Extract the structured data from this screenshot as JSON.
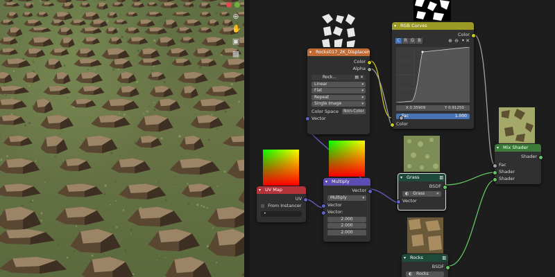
{
  "viewport": {
    "tools": [
      "hand-icon",
      "camera-icon",
      "grid-icon"
    ]
  },
  "nodes": {
    "rocks_texture": {
      "title": "Rocks017_2K_Displacement...",
      "outputs": [
        "Color",
        "Alpha"
      ],
      "image_name": "Rock...",
      "interpolation": "Linear",
      "projection": "Flat",
      "extension": "Repeat",
      "source": "Single Image",
      "color_space_label": "Color Space",
      "color_space_value": "Non-Color",
      "input": "Vector"
    },
    "rgb_curves": {
      "title": "RGB Curves",
      "output": "Color",
      "channels": [
        "C",
        "R",
        "G",
        "B"
      ],
      "point_x": "X 0.35909",
      "point_y": "Y 0.91250",
      "fac_label": "Fac",
      "fac_value": "1.000",
      "input": "Color"
    },
    "uv_map": {
      "title": "UV Map",
      "output": "UV",
      "from_instancer": "From Instancer",
      "field_value": "•"
    },
    "multiply": {
      "title": "Multiply",
      "output": "Vector",
      "operation": "Multiply",
      "input": "Vector",
      "vector_label": "Vector:",
      "values": [
        "2.000",
        "2.000",
        "2.000"
      ]
    },
    "grass": {
      "title": "Grass",
      "output": "BSDF",
      "group_name": "Grass",
      "input": "Vector"
    },
    "mix_shader": {
      "title": "Mix Shader",
      "output": "Shader",
      "inputs": [
        "Fac",
        "Shader",
        "Shader"
      ]
    },
    "rocks_group": {
      "title": "Rocks",
      "output": "BSDF",
      "group_name": "Rocks"
    }
  },
  "colors": {
    "texture_header": "#c06a34",
    "curve_header": "#9b9a24",
    "uv_header": "#b3333a",
    "vector_header": "#5c4db3",
    "group_header": "#1e4a3a",
    "mix_header": "#3c7a3a",
    "fac_bar": "#4772b3"
  }
}
